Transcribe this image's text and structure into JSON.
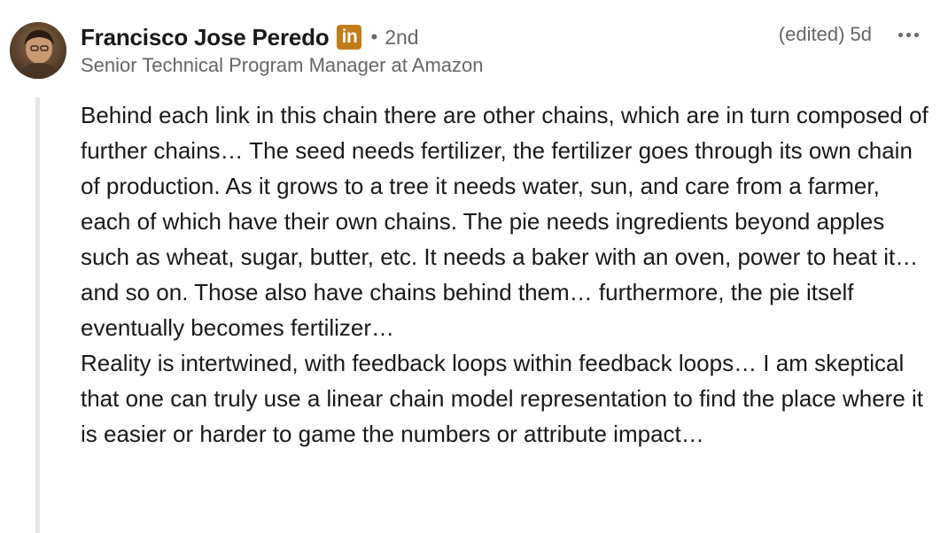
{
  "comment": {
    "author": {
      "name": "Francisco Jose Peredo",
      "badge": "in",
      "separator": "•",
      "degree": "2nd",
      "headline": "Senior Technical Program Manager at Amazon"
    },
    "meta": {
      "edited_label": "(edited)",
      "age": "5d"
    },
    "more_icon": "ellipsis-horizontal-icon",
    "paragraphs": [
      "Behind each link in this chain there are other chains, which are in turn composed of further chains… The seed needs fertilizer, the fertilizer goes through its own chain of production. As it grows to a tree it needs water, sun, and care from a farmer, each of which have their own chains. The pie needs ingredients beyond apples such as wheat, sugar, butter, etc. It needs a baker with an oven, power to heat it… and so on. Those also have chains behind them… furthermore, the pie itself eventually becomes fertilizer…",
      "Reality is intertwined, with feedback loops within feedback loops… I am skeptical that one can truly use a linear chain model representation to find the place where it is easier or harder to game the numbers or attribute impact…"
    ]
  },
  "colors": {
    "badge": "#c37d16",
    "muted_text": "#666666",
    "body_text": "#191919",
    "thread_line": "#e8e6e1"
  }
}
